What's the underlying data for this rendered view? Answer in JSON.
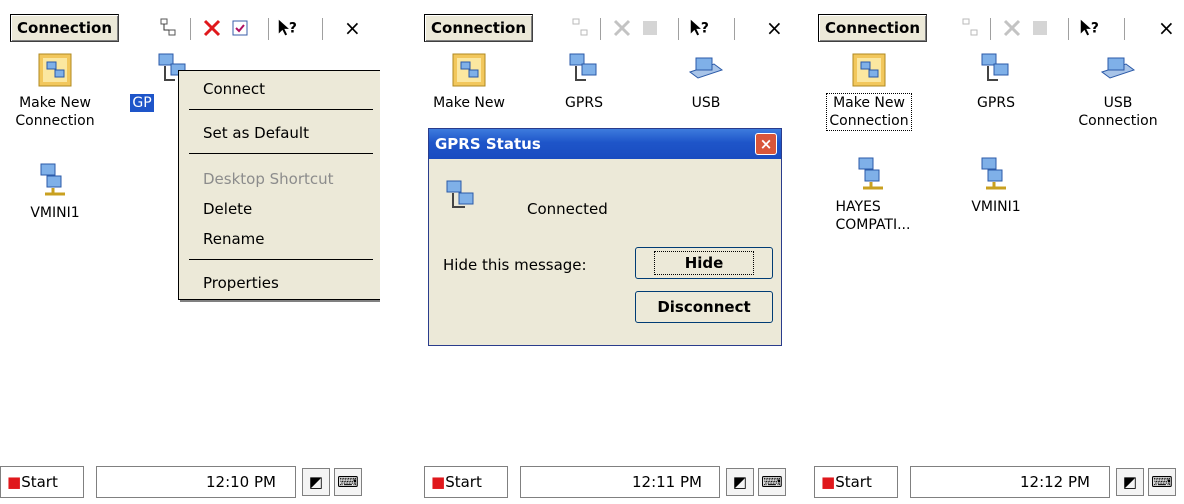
{
  "panels": [
    {
      "toolbar": {
        "title": "Connection",
        "close": "×"
      },
      "icons": {
        "make_new": "Make New\nConnection",
        "gprs_partial": "GP",
        "vmini1": "VMINI1"
      },
      "context_menu": {
        "items": [
          "Connect",
          "Set as Default",
          "Desktop Shortcut",
          "Delete",
          "Rename",
          "Properties"
        ]
      },
      "taskbar": {
        "start": "Start",
        "time": "12:10 PM"
      }
    },
    {
      "toolbar": {
        "title": "Connection",
        "close": "×"
      },
      "icons": {
        "make_new": "Make New",
        "gprs": "GPRS",
        "usb": "USB"
      },
      "dialog": {
        "title": "GPRS Status",
        "close": "×",
        "status": "Connected",
        "hide_label": "Hide this message:",
        "hide_button": "Hide",
        "disconnect_button": "Disconnect"
      },
      "taskbar": {
        "start": "Start",
        "time": "12:11 PM"
      }
    },
    {
      "toolbar": {
        "title": "Connection",
        "close": "×"
      },
      "icons": {
        "make_new": "Make New\nConnection",
        "gprs": "GPRS",
        "usb": "USB\nConnection",
        "hayes": "HAYES\nCOMPATI...",
        "vmini1": "VMINI1"
      },
      "taskbar": {
        "start": "Start",
        "time": "12:12 PM"
      }
    }
  ],
  "colors": {
    "titlebar_blue": "#1e55c9",
    "dialog_bg": "#ece9d8",
    "toolbar_delete_red": "#e0181c",
    "close_button_red": "#d9563a"
  }
}
